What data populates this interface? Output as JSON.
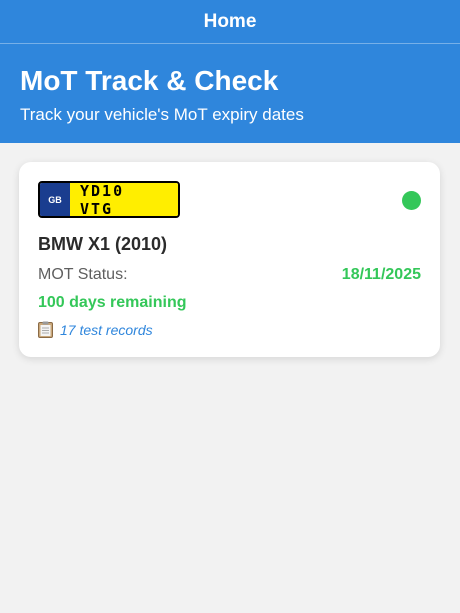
{
  "navbar": {
    "title": "Home"
  },
  "hero": {
    "title": "MoT Track & Check",
    "subtitle": "Track your vehicle's MoT expiry dates"
  },
  "vehicles": [
    {
      "plate_country": "GB",
      "plate_number": "YD10 VTG",
      "name": "BMW X1 (2010)",
      "status_label": "MOT Status:",
      "expiry_date": "18/11/2025",
      "days_remaining": "100 days remaining",
      "test_records": "17 test records",
      "status_color": "#34c759",
      "records_icon": "clipboard-icon"
    }
  ],
  "colors": {
    "primary": "#2f86dc",
    "success": "#34c759",
    "plate_yellow": "#ffee00",
    "plate_blue": "#1a3d8f"
  }
}
